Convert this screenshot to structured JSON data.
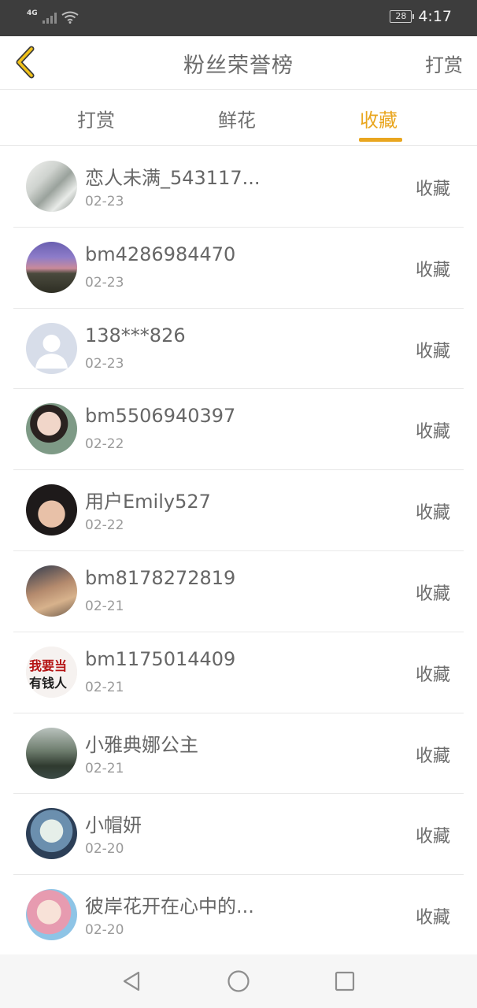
{
  "status_bar": {
    "network": "4G",
    "battery": "28",
    "time": "4:17"
  },
  "header": {
    "title": "粉丝荣誉榜",
    "action": "打赏"
  },
  "tabs": [
    {
      "label": "打赏",
      "active": false
    },
    {
      "label": "鲜花",
      "active": false
    },
    {
      "label": "收藏",
      "active": true
    }
  ],
  "fans": [
    {
      "name": "恋人未满_543117...",
      "date": "02-23",
      "action": "收藏"
    },
    {
      "name": "bm4286984470",
      "date": "02-23",
      "action": "收藏"
    },
    {
      "name": "138***826",
      "date": "02-23",
      "action": "收藏"
    },
    {
      "name": "bm5506940397",
      "date": "02-22",
      "action": "收藏"
    },
    {
      "name": "用户Emily527",
      "date": "02-22",
      "action": "收藏"
    },
    {
      "name": "bm8178272819",
      "date": "02-21",
      "action": "收藏"
    },
    {
      "name": "bm1175014409",
      "date": "02-21",
      "action": "收藏"
    },
    {
      "name": "小雅典娜公主",
      "date": "02-21",
      "action": "收藏"
    },
    {
      "name": "小帽妍",
      "date": "02-20",
      "action": "收藏"
    },
    {
      "name": "彼岸花开在心中的...",
      "date": "02-20",
      "action": "收藏"
    }
  ],
  "avatar_text": "我要当有钱人",
  "colors": {
    "accent": "#e9a61f",
    "status_bar": "#3d3d3d",
    "text": "#666666",
    "subtext": "#9a9a9a"
  },
  "icons": {
    "back": "chevron-left-icon",
    "nav_back": "triangle-back-icon",
    "nav_home": "circle-home-icon",
    "nav_recent": "square-recent-icon"
  }
}
